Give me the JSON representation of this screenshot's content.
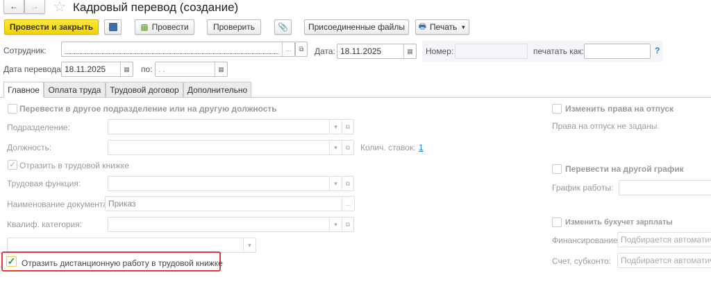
{
  "header": {
    "title": "Кадровый перевод (создание)"
  },
  "toolbar": {
    "post_close": "Провести и закрыть",
    "post": "Провести",
    "check": "Проверить",
    "attached": "Присоединенные файлы",
    "print": "Печать"
  },
  "form": {
    "employee_label": "Сотрудник:",
    "employee_value": "",
    "date_label": "Дата:",
    "date_value": "18.11.2025",
    "number_label": "Номер:",
    "number_value": "",
    "print_as_label": "печатать как:",
    "print_as_value": "",
    "help": "?",
    "transfer_date_label": "Дата перевода:",
    "transfer_date_value": "18.11.2025",
    "to_label": "по:",
    "to_value": " .  ."
  },
  "tabs": [
    {
      "label": "Главное"
    },
    {
      "label": "Оплата труда"
    },
    {
      "label": "Трудовой договор"
    },
    {
      "label": "Дополнительно"
    }
  ],
  "main": {
    "transfer_cb": "Перевести в другое подразделение или на другую должность",
    "department_label": "Подразделение:",
    "position_label": "Должность:",
    "rates_label": "Колич. ставок:",
    "rates_value": "1",
    "workbook_cb": "Отразить в трудовой книжке",
    "labor_function_label": "Трудовая функция:",
    "doc_name_label": "Наименование документа:",
    "doc_name_value": "Приказ",
    "qualif_label": "Квалиф. категория:",
    "remote_cb": "Отразить дистанционную работу в трудовой книжке"
  },
  "right": {
    "vacation_cb": "Изменить права на отпуск",
    "vacation_text": "Права на отпуск не заданы.",
    "schedule_cb": "Перевести на другой график",
    "schedule_label": "График работы:",
    "accounting_cb": "Изменить бухучет зарплаты",
    "financing_label": "Финансирование:",
    "financing_placeholder": "Подбирается автоматически",
    "account_label": "Счет, субконто:",
    "account_placeholder": "Подбирается автоматически"
  }
}
